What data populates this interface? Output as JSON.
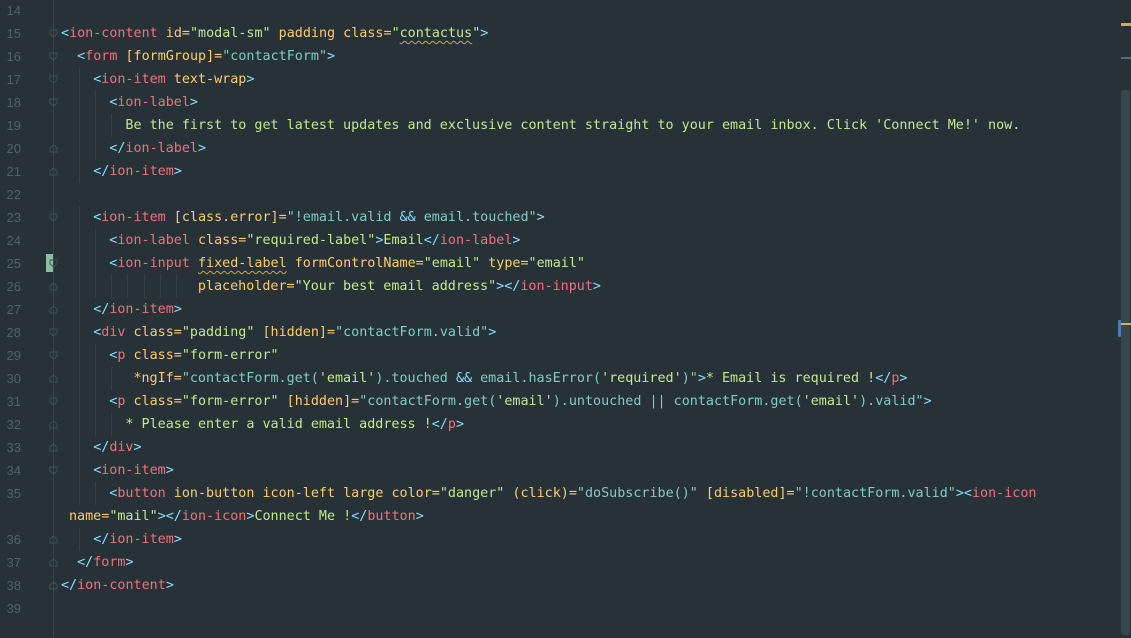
{
  "editor": {
    "theme_colors": {
      "background": "#263238",
      "tag": "#f07178",
      "punctuation": "#89ddff",
      "attribute": "#ffcb6b",
      "string": "#c3e88d",
      "expression": "#80cbc4",
      "line_number": "#4f6169"
    },
    "lines": [
      {
        "n": "14",
        "indent": 0,
        "fold": "",
        "tokens": []
      },
      {
        "n": "15",
        "indent": 0,
        "fold": "open",
        "tokens": [
          [
            "punc",
            "<"
          ],
          [
            "tag",
            "ion-content"
          ],
          [
            "attr",
            " id="
          ],
          [
            "str",
            "\"modal-sm\""
          ],
          [
            "attr",
            " padding class="
          ],
          [
            "str",
            "\""
          ],
          [
            "strw",
            "contactus"
          ],
          [
            "str",
            "\""
          ],
          [
            "punc",
            ">"
          ]
        ]
      },
      {
        "n": "16",
        "indent": 2,
        "fold": "open",
        "tokens": [
          [
            "punc",
            "<"
          ],
          [
            "tag",
            "form"
          ],
          [
            "attr",
            " [formGroup]="
          ],
          [
            "expr",
            "\"contactForm\""
          ],
          [
            "punc",
            ">"
          ]
        ]
      },
      {
        "n": "17",
        "indent": 4,
        "fold": "open",
        "tokens": [
          [
            "punc",
            "<"
          ],
          [
            "tag",
            "ion-item"
          ],
          [
            "attr",
            " text-wrap"
          ],
          [
            "punc",
            ">"
          ]
        ]
      },
      {
        "n": "18",
        "indent": 6,
        "fold": "open",
        "tokens": [
          [
            "punc",
            "<"
          ],
          [
            "tag",
            "ion-label"
          ],
          [
            "punc",
            ">"
          ]
        ]
      },
      {
        "n": "19",
        "indent": 8,
        "fold": "",
        "tokens": [
          [
            "text",
            "Be the first to get latest updates and exclusive content straight to your email inbox. Click 'Connect Me!' now."
          ]
        ]
      },
      {
        "n": "20",
        "indent": 6,
        "fold": "close",
        "tokens": [
          [
            "punc",
            "</"
          ],
          [
            "tag",
            "ion-label"
          ],
          [
            "punc",
            ">"
          ]
        ]
      },
      {
        "n": "21",
        "indent": 4,
        "fold": "close",
        "tokens": [
          [
            "punc",
            "</"
          ],
          [
            "tag",
            "ion-item"
          ],
          [
            "punc",
            ">"
          ]
        ]
      },
      {
        "n": "22",
        "indent": 0,
        "fold": "",
        "tokens": []
      },
      {
        "n": "23",
        "indent": 4,
        "fold": "open",
        "tokens": [
          [
            "punc",
            "<"
          ],
          [
            "tag",
            "ion-item"
          ],
          [
            "attr",
            " [class.error]="
          ],
          [
            "expr",
            "\"!email.valid "
          ],
          [
            "op",
            "&&"
          ],
          [
            "expr",
            " email.touched\""
          ],
          [
            "punc",
            ">"
          ]
        ]
      },
      {
        "n": "24",
        "indent": 6,
        "fold": "",
        "tokens": [
          [
            "punc",
            "<"
          ],
          [
            "tag",
            "ion-label"
          ],
          [
            "attr",
            " class="
          ],
          [
            "str",
            "\"required-label\""
          ],
          [
            "punc",
            ">"
          ],
          [
            "text",
            "Email"
          ],
          [
            "punc",
            "</"
          ],
          [
            "tag",
            "ion-label"
          ],
          [
            "punc",
            ">"
          ]
        ]
      },
      {
        "n": "25",
        "indent": 6,
        "fold": "open",
        "cursor": true,
        "tokens": [
          [
            "punc",
            "<"
          ],
          [
            "tag",
            "ion-input"
          ],
          [
            "attr",
            " "
          ],
          [
            "attrw",
            "fixed-label"
          ],
          [
            "attr",
            " formControlName="
          ],
          [
            "str",
            "\"email\""
          ],
          [
            "attr",
            " type="
          ],
          [
            "str",
            "\"email\""
          ]
        ]
      },
      {
        "n": "26",
        "indent": 17,
        "fold": "close",
        "tokens": [
          [
            "attr",
            "placeholder="
          ],
          [
            "str",
            "\"Your best email address\""
          ],
          [
            "punc",
            "></"
          ],
          [
            "tag",
            "ion-input"
          ],
          [
            "punc",
            ">"
          ]
        ]
      },
      {
        "n": "27",
        "indent": 4,
        "fold": "close",
        "tokens": [
          [
            "punc",
            "</"
          ],
          [
            "tag",
            "ion-item"
          ],
          [
            "punc",
            ">"
          ]
        ]
      },
      {
        "n": "28",
        "indent": 4,
        "fold": "open",
        "tokens": [
          [
            "punc",
            "<"
          ],
          [
            "tag",
            "div"
          ],
          [
            "attr",
            " class="
          ],
          [
            "str",
            "\"padding\""
          ],
          [
            "attr",
            " [hidden]="
          ],
          [
            "expr",
            "\"contactForm.valid\""
          ],
          [
            "punc",
            ">"
          ]
        ]
      },
      {
        "n": "29",
        "indent": 6,
        "fold": "open",
        "tokens": [
          [
            "punc",
            "<"
          ],
          [
            "tag",
            "p"
          ],
          [
            "attr",
            " class="
          ],
          [
            "str",
            "\"form-error\""
          ]
        ]
      },
      {
        "n": "30",
        "indent": 9,
        "fold": "close",
        "tokens": [
          [
            "attr",
            "*ngIf="
          ],
          [
            "expr",
            "\"contactForm.get("
          ],
          [
            "str",
            "'email'"
          ],
          [
            "expr",
            ").touched "
          ],
          [
            "op",
            "&&"
          ],
          [
            "expr",
            " email.hasError("
          ],
          [
            "str",
            "'required'"
          ],
          [
            "expr",
            ")\""
          ],
          [
            "punc",
            ">"
          ],
          [
            "text",
            "* Email is required !"
          ],
          [
            "punc",
            "</"
          ],
          [
            "tag",
            "p"
          ],
          [
            "punc",
            ">"
          ]
        ]
      },
      {
        "n": "31",
        "indent": 6,
        "fold": "open",
        "tokens": [
          [
            "punc",
            "<"
          ],
          [
            "tag",
            "p"
          ],
          [
            "attr",
            " class="
          ],
          [
            "str",
            "\"form-error\""
          ],
          [
            "attr",
            " [hidden]="
          ],
          [
            "expr",
            "\"contactForm.get("
          ],
          [
            "str",
            "'email'"
          ],
          [
            "expr",
            ").untouched || contactForm.get("
          ],
          [
            "str",
            "'email'"
          ],
          [
            "expr",
            ").valid\""
          ],
          [
            "punc",
            ">"
          ]
        ]
      },
      {
        "n": "32",
        "indent": 8,
        "fold": "close",
        "tokens": [
          [
            "text",
            "* Please enter a valid email address !"
          ],
          [
            "punc",
            "</"
          ],
          [
            "tag",
            "p"
          ],
          [
            "punc",
            ">"
          ]
        ]
      },
      {
        "n": "33",
        "indent": 4,
        "fold": "close",
        "tokens": [
          [
            "punc",
            "</"
          ],
          [
            "tag",
            "div"
          ],
          [
            "punc",
            ">"
          ]
        ]
      },
      {
        "n": "34",
        "indent": 4,
        "fold": "open",
        "tokens": [
          [
            "punc",
            "<"
          ],
          [
            "tag",
            "ion-item"
          ],
          [
            "punc",
            ">"
          ]
        ]
      },
      {
        "n": "35",
        "indent": 6,
        "fold": "",
        "tokens": [
          [
            "punc",
            "<"
          ],
          [
            "tag",
            "button"
          ],
          [
            "attr",
            " ion-button icon-left large color="
          ],
          [
            "str",
            "\"danger\""
          ],
          [
            "attr",
            " (click)="
          ],
          [
            "expr",
            "\"doSubscribe()\""
          ],
          [
            "attr",
            " [disabled]="
          ],
          [
            "expr",
            "\"!contactForm.valid\""
          ],
          [
            "punc",
            ">"
          ],
          [
            "punc",
            "<"
          ],
          [
            "tag",
            "ion-icon"
          ]
        ]
      },
      {
        "n": "",
        "indent": 1,
        "fold": "",
        "wrap": true,
        "tokens": [
          [
            "attr",
            "name="
          ],
          [
            "str",
            "\"mail\""
          ],
          [
            "punc",
            "></"
          ],
          [
            "tag",
            "ion-icon"
          ],
          [
            "punc",
            ">"
          ],
          [
            "text",
            "Connect Me !"
          ],
          [
            "punc",
            "</"
          ],
          [
            "tag",
            "button"
          ],
          [
            "punc",
            ">"
          ]
        ]
      },
      {
        "n": "36",
        "indent": 4,
        "fold": "close",
        "tokens": [
          [
            "punc",
            "</"
          ],
          [
            "tag",
            "ion-item"
          ],
          [
            "punc",
            ">"
          ]
        ]
      },
      {
        "n": "37",
        "indent": 2,
        "fold": "close",
        "tokens": [
          [
            "punc",
            "</"
          ],
          [
            "tag",
            "form"
          ],
          [
            "punc",
            ">"
          ]
        ]
      },
      {
        "n": "38",
        "indent": 0,
        "fold": "close",
        "tokens": [
          [
            "punc",
            "</"
          ],
          [
            "tag",
            "ion-content"
          ],
          [
            "punc",
            ">"
          ]
        ]
      },
      {
        "n": "39",
        "indent": 0,
        "fold": "",
        "tokens": []
      }
    ]
  }
}
